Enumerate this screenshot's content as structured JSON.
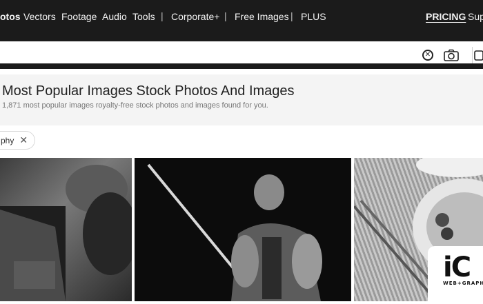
{
  "nav": {
    "items": [
      "otos",
      "Vectors",
      "Footage",
      "Audio",
      "Tools",
      "|",
      "Corporate+",
      "|",
      "Free Images",
      "|",
      "PLUS"
    ],
    "pricing": "PRICING",
    "support": "Sup"
  },
  "search": {
    "value": "",
    "placeholder": "",
    "clear_icon": "close-circle-icon",
    "camera_icon": "camera-icon"
  },
  "page": {
    "title": "Most Popular Images Stock Photos And Images",
    "subtitle": "1,871 most popular images royalty-free stock photos and images found for you."
  },
  "filter_chip": {
    "label": "phy",
    "remove_icon": "close-icon"
  },
  "gallery": {
    "items": [
      {
        "alt": "laptop-with-plant"
      },
      {
        "alt": "man-with-sword"
      },
      {
        "alt": "noodles-with-chopsticks"
      }
    ]
  },
  "badge": {
    "big": "iC",
    "small": "WEB+GRAPH"
  }
}
